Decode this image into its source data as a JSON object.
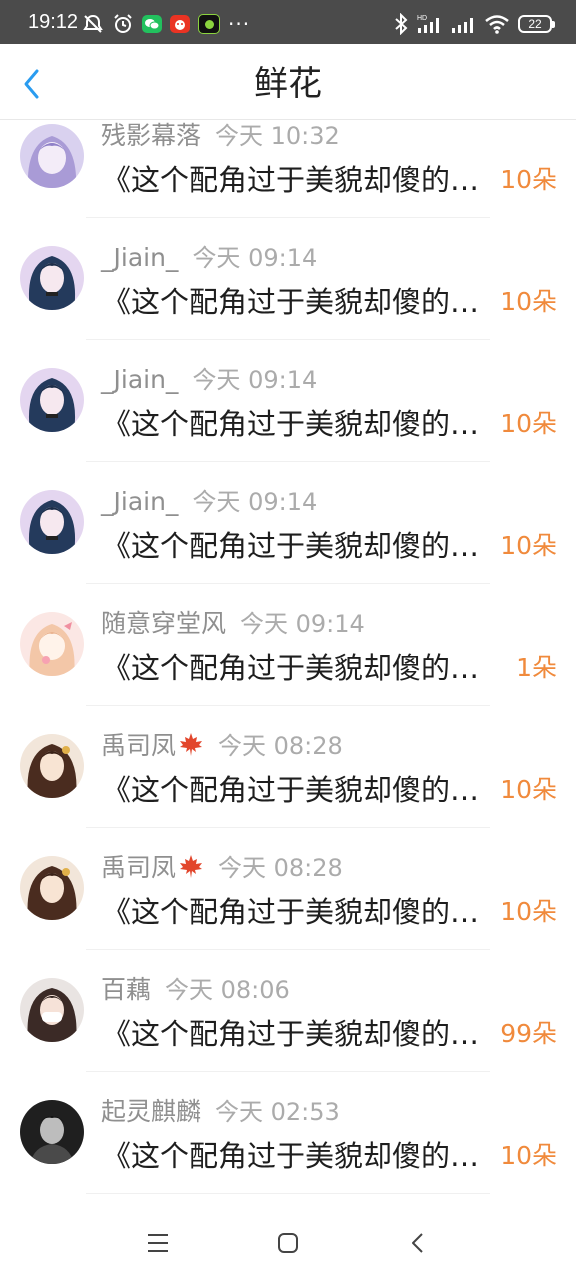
{
  "status_bar": {
    "time": "19:12",
    "battery": "22",
    "icons_left": [
      "muted-icon",
      "alarm-icon",
      "wechat-icon",
      "app-red-icon",
      "app-green-icon",
      "more-dots-icon"
    ],
    "icons_right": [
      "bluetooth-icon",
      "hd-signal-icon",
      "signal-icon",
      "wifi-icon",
      "battery-icon"
    ],
    "colors": {
      "background": "#4b4b4b",
      "wechat": "#22c15e",
      "red_app": "#ea3323",
      "green_app": "#8bd43e"
    }
  },
  "header": {
    "title": "鲜花",
    "back_icon": "chevron-left-icon",
    "accent_color": "#2a9cf0"
  },
  "gifts": [
    {
      "user": "残影幕落",
      "time": "今天 10:32",
      "message": "《这个配角过于美貌却傻的在线等》",
      "count": "10朵",
      "avatar_icon": "avatar-purple-hair"
    },
    {
      "user": "_Jiain_",
      "time": "今天 09:14",
      "message": "《这个配角过于美貌却傻的在线等》",
      "count": "10朵",
      "avatar_icon": "avatar-dark-hair"
    },
    {
      "user": "_Jiain_",
      "time": "今天 09:14",
      "message": "《这个配角过于美貌却傻的在线等》",
      "count": "10朵",
      "avatar_icon": "avatar-dark-hair"
    },
    {
      "user": "_Jiain_",
      "time": "今天 09:14",
      "message": "《这个配角过于美貌却傻的在线等》",
      "count": "10朵",
      "avatar_icon": "avatar-dark-hair"
    },
    {
      "user": "随意穿堂风",
      "time": "今天 09:14",
      "message": "《这个配角过于美貌却傻的在线等》",
      "count": "1朵",
      "avatar_icon": "avatar-pink-girl"
    },
    {
      "user": "禹司凤",
      "time": "今天 08:28",
      "message": "《这个配角过于美貌却傻的在线等》",
      "count": "10朵",
      "avatar_icon": "avatar-brown-hair",
      "badge_icon": "maple-leaf-icon"
    },
    {
      "user": "禹司凤",
      "time": "今天 08:28",
      "message": "《这个配角过于美貌却傻的在线等》",
      "count": "10朵",
      "avatar_icon": "avatar-brown-hair",
      "badge_icon": "maple-leaf-icon"
    },
    {
      "user": "百藕",
      "time": "今天 08:06",
      "message": "《这个配角过于美貌却傻的在线等》",
      "count": "99朵",
      "avatar_icon": "avatar-photo-girl"
    },
    {
      "user": "起灵麒麟",
      "time": "今天 02:53",
      "message": "《这个配角过于美貌却傻的在线等》",
      "count": "10朵",
      "avatar_icon": "avatar-monochrome"
    }
  ],
  "list_colors": {
    "name": "#8f8f8f",
    "time": "#ababab",
    "message": "#1e1e1e",
    "count": "#f08a3c"
  },
  "nav": {
    "menu_icon": "menu-icon",
    "home_icon": "home-square-icon",
    "back_icon": "back-triangle-icon"
  }
}
